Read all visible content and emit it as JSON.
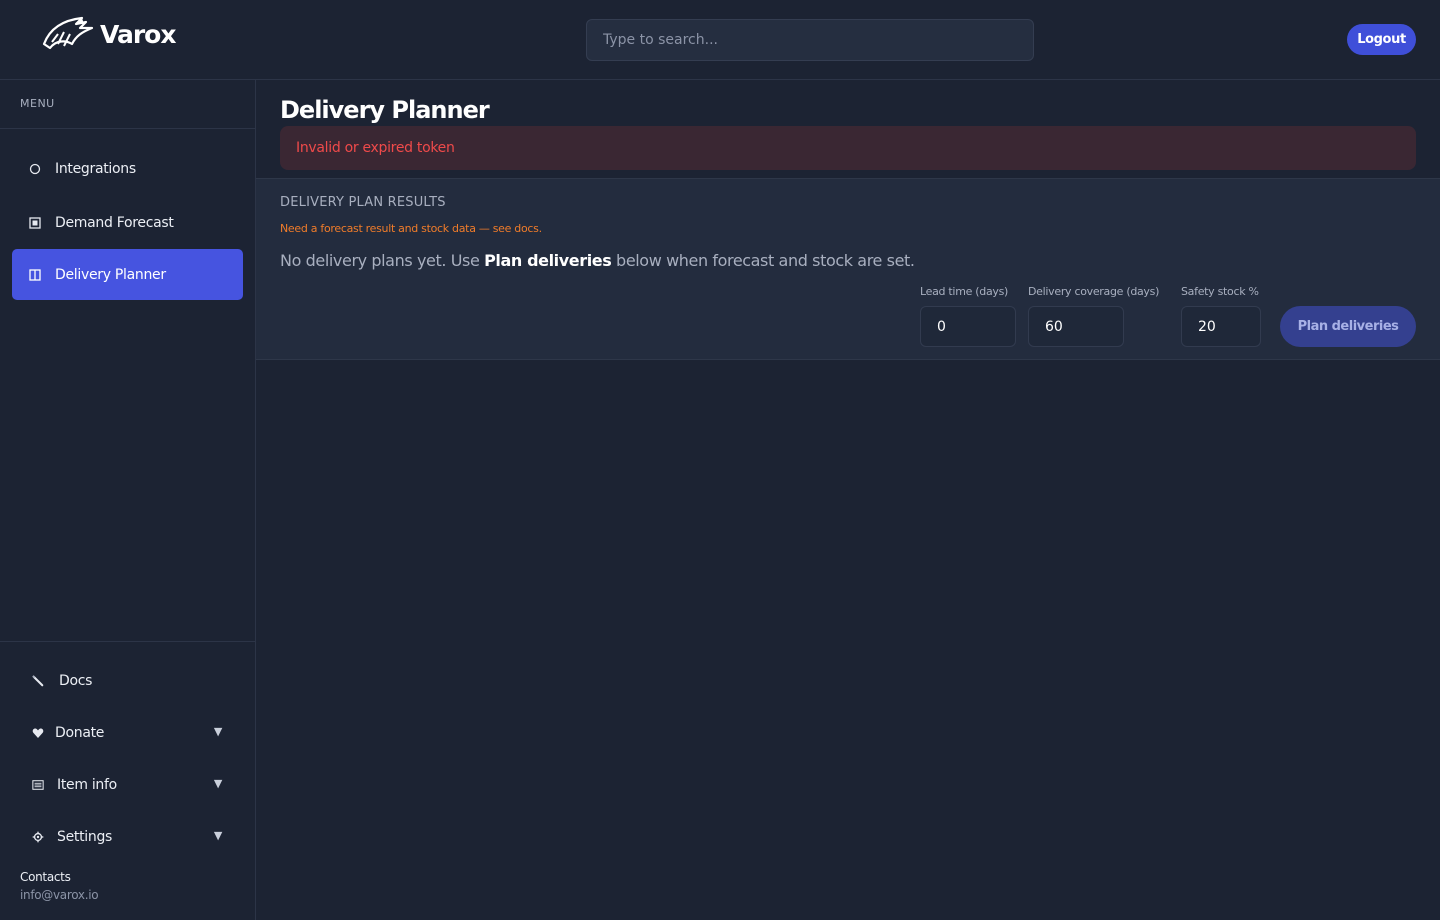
{
  "brand": {
    "name": "Varox"
  },
  "search": {
    "placeholder": "Type to search..."
  },
  "header": {
    "logout_label": "Logout"
  },
  "sidebar": {
    "menu_label": "MENU",
    "items": [
      {
        "label": "Integrations",
        "icon": "circle-icon"
      },
      {
        "label": "Demand Forecast",
        "icon": "square-icon"
      },
      {
        "label": "Delivery Planner",
        "icon": "columns-icon",
        "active": true
      }
    ],
    "bottom_items": [
      {
        "label": "Docs",
        "icon": "pencil-icon"
      },
      {
        "label": "Donate",
        "icon": "heart-icon",
        "caret": "▼"
      },
      {
        "label": "Item info",
        "icon": "list-icon",
        "caret": "▼"
      },
      {
        "label": "Settings",
        "icon": "gear-icon",
        "caret": "▼"
      }
    ],
    "contacts": {
      "title": "Contacts",
      "email": "info@varox.io"
    }
  },
  "main": {
    "title": "Delivery Planner",
    "error": "Invalid or expired token",
    "results": {
      "title": "DELIVERY PLAN RESULTS",
      "warning": "Need a forecast result and stock data — see docs.",
      "message_before": "No delivery plans yet. Use ",
      "message_bold": "Plan deliveries",
      "message_after": " below when forecast and stock are set."
    },
    "fields": {
      "lead_time": {
        "label": "Lead time (days)",
        "value": "0"
      },
      "coverage": {
        "label": "Delivery coverage (days)",
        "value": "60"
      },
      "safety": {
        "label": "Safety stock %",
        "value": "20"
      }
    },
    "plan_button": "Plan deliveries"
  },
  "colors": {
    "background": "#1c2333",
    "accent": "#4654e0",
    "error": "#ef4a4a",
    "warning": "#f07c2a"
  }
}
